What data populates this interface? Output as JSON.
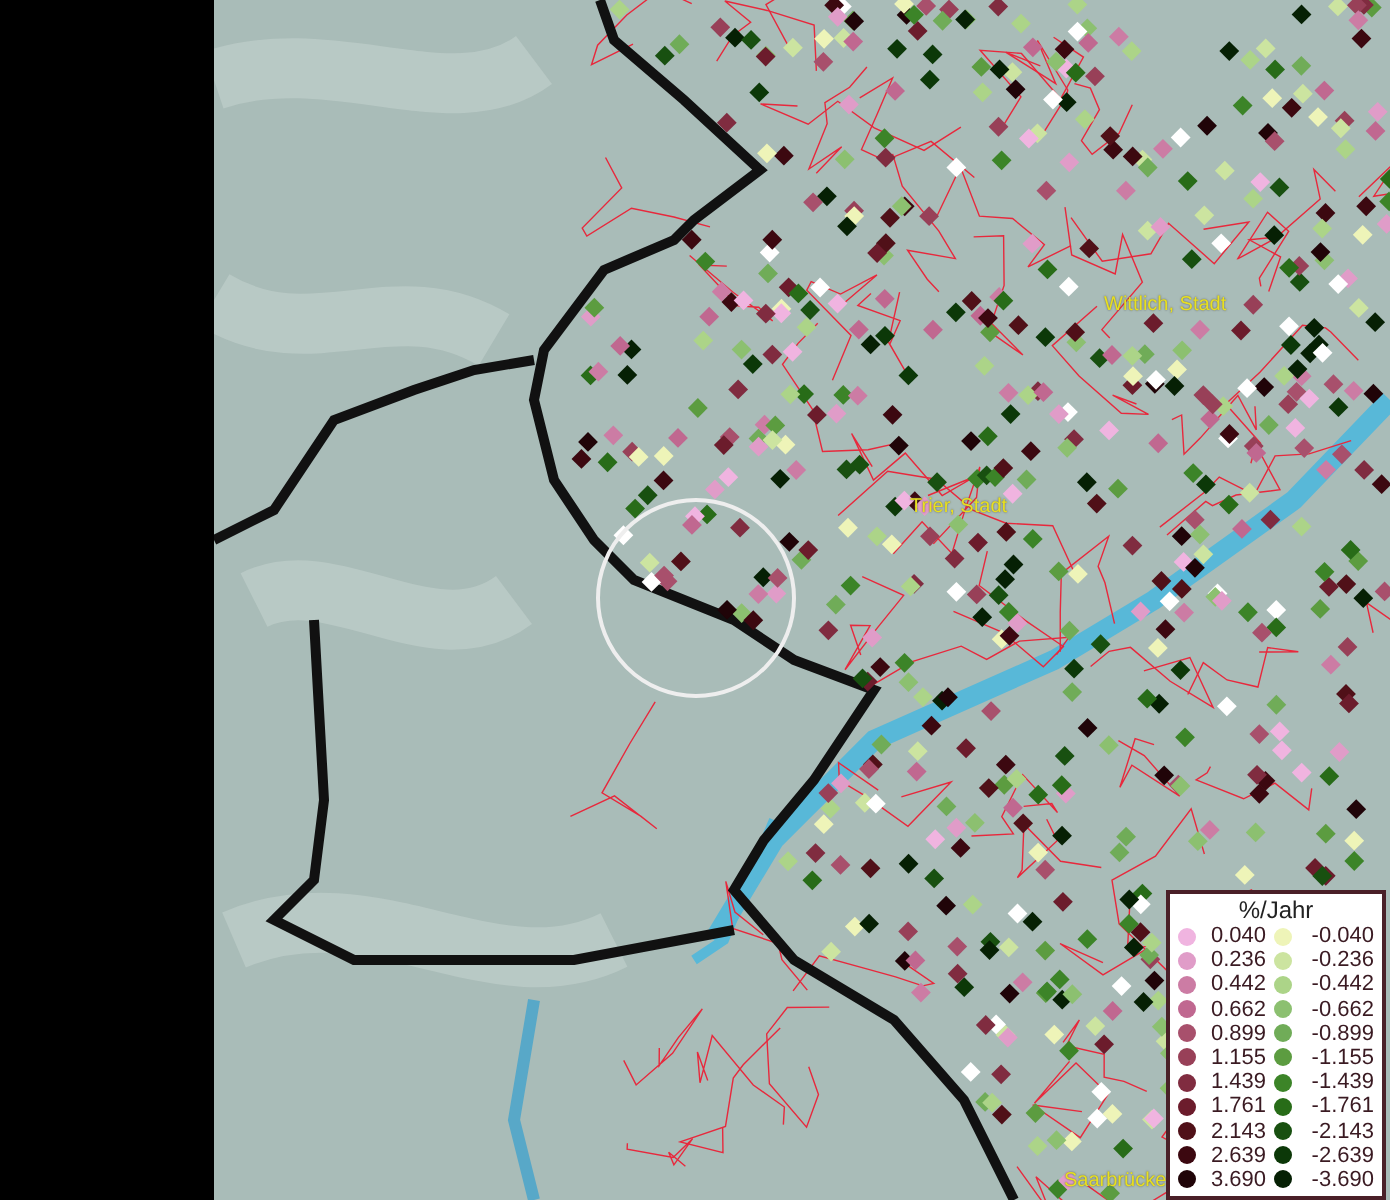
{
  "map_labels": [
    {
      "text": "Wittlich, Stadt"
    },
    {
      "text": "Trier, Stadt"
    },
    {
      "text": "Saarbrücke"
    }
  ],
  "legend": {
    "title": "%/Jahr",
    "increase": [
      {
        "value": "0.040",
        "color": "#f0b4e0"
      },
      {
        "value": "0.236",
        "color": "#e09cc8"
      },
      {
        "value": "0.442",
        "color": "#cc7ca4"
      },
      {
        "value": "0.662",
        "color": "#c06890"
      },
      {
        "value": "0.899",
        "color": "#a8506c"
      },
      {
        "value": "1.155",
        "color": "#984058"
      },
      {
        "value": "1.439",
        "color": "#802c40"
      },
      {
        "value": "1.761",
        "color": "#6c1c2c"
      },
      {
        "value": "2.143",
        "color": "#501018"
      },
      {
        "value": "2.639",
        "color": "#3c0810"
      },
      {
        "value": "3.690",
        "color": "#200408"
      }
    ],
    "decrease": [
      {
        "value": "-0.040",
        "color": "#eef4b8"
      },
      {
        "value": "-0.236",
        "color": "#cce4a0"
      },
      {
        "value": "-0.442",
        "color": "#acd488"
      },
      {
        "value": "-0.662",
        "color": "#8cc070"
      },
      {
        "value": "-0.899",
        "color": "#70ac58"
      },
      {
        "value": "-1.155",
        "color": "#5c9c40"
      },
      {
        "value": "-1.439",
        "color": "#3c8428"
      },
      {
        "value": "-1.761",
        "color": "#286c18"
      },
      {
        "value": "-2.143",
        "color": "#185010"
      },
      {
        "value": "-2.639",
        "color": "#0c3808"
      },
      {
        "value": "-3.690",
        "color": "#062004"
      }
    ]
  }
}
